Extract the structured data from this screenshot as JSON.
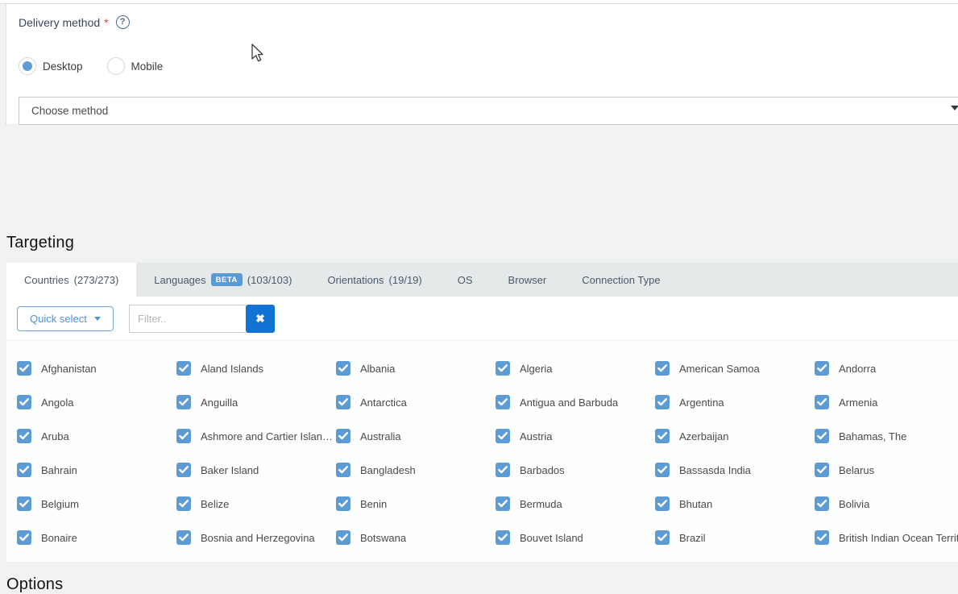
{
  "delivery": {
    "label": "Delivery method",
    "required_marker": "*",
    "help_icon_glyph": "?",
    "radios": [
      {
        "label": "Desktop",
        "selected": true
      },
      {
        "label": "Mobile",
        "selected": false
      }
    ],
    "method_select": {
      "value": "Choose method"
    }
  },
  "targeting": {
    "title": "Targeting",
    "tabs": [
      {
        "label": "Countries",
        "count": "(273/273)",
        "active": true
      },
      {
        "label": "Languages",
        "badge": "BETA",
        "count": "(103/103)",
        "active": false
      },
      {
        "label": "Orientations",
        "count": "(19/19)",
        "active": false
      },
      {
        "label": "OS",
        "active": false
      },
      {
        "label": "Browser",
        "active": false
      },
      {
        "label": "Connection Type",
        "active": false
      }
    ],
    "toolbar": {
      "quick_select_label": "Quick select",
      "filter_placeholder": "Filter..",
      "filter_value": "",
      "clear_icon": "✖"
    },
    "countries_all_checked": true,
    "countries": [
      "Afghanistan",
      "Aland Islands",
      "Albania",
      "Algeria",
      "American Samoa",
      "Andorra",
      "Angola",
      "Anguilla",
      "Antarctica",
      "Antigua and Barbuda",
      "Argentina",
      "Armenia",
      "Aruba",
      "Ashmore and Cartier Islan…",
      "Australia",
      "Austria",
      "Azerbaijan",
      "Bahamas, The",
      "Bahrain",
      "Baker Island",
      "Bangladesh",
      "Barbados",
      "Bassasda India",
      "Belarus",
      "Belgium",
      "Belize",
      "Benin",
      "Bermuda",
      "Bhutan",
      "Bolivia",
      "Bonaire",
      "Bosnia and Herzegovina",
      "Botswana",
      "Bouvet Island",
      "Brazil",
      "British Indian Ocean Territ…"
    ]
  },
  "options_section": {
    "title": "Options"
  },
  "colors": {
    "checkbox_blue": "#5c9bd3",
    "clear_button_blue": "#1173d4",
    "beta_badge_blue": "#5b9bd5",
    "quick_select_blue": "#4a90d4",
    "asterisk_red": "#e0452e",
    "tabbar_gray": "#e6e9e9",
    "page_background": "#f1f2f2"
  }
}
